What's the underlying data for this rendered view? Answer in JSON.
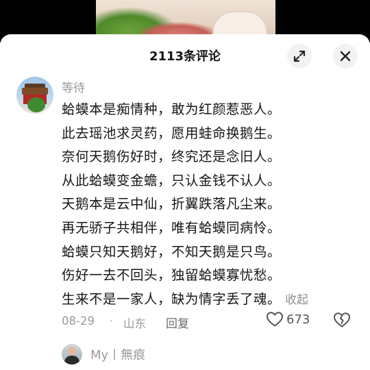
{
  "header": {
    "title": "2113条评论"
  },
  "comment": {
    "username": "等待",
    "lines": [
      "蛤蟆本是痴情种，敢为红颜惹恶人。",
      "此去瑶池求灵药，愿用蛙命换鹅生。",
      "奈何天鹅伤好时，终究还是念旧人。",
      "从此蛤蟆变金蟾，只认金钱不认人。",
      "天鹅本是云中仙，折翼跌落凡尘来。",
      "再无骄子共相伴，唯有蛤蟆同病怜。",
      "蛤蟆只知天鹅好，不知天鹅是只鸟。",
      "伤好一去不回头，独留蛤蟆寡忧愁。",
      "生来不是一家人，缺为情字丢了魂。"
    ],
    "collapse_label": "收起",
    "date": "08-29",
    "separator": "·",
    "location": "山东",
    "reply_label": "回复",
    "like_count": "673"
  },
  "reply_preview": {
    "name": "My丨無痕"
  },
  "icons": {
    "expand": "expand-icon",
    "close": "close-icon",
    "like": "heart-icon",
    "dislike": "broken-heart-icon"
  }
}
